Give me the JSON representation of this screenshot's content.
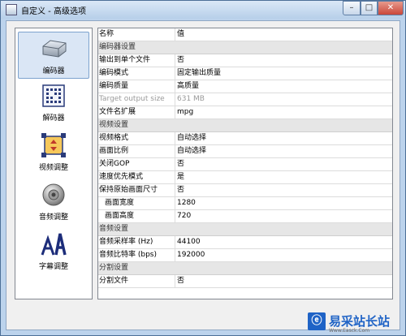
{
  "window": {
    "title": "自定义 - 高级选项",
    "buttons": {
      "minimize": "–",
      "maximize": "□",
      "close": "✕"
    }
  },
  "sidebar": {
    "items": [
      {
        "label": "编码器",
        "icon": "encoder-drive-icon",
        "selected": true
      },
      {
        "label": "解码器",
        "icon": "decoder-chip-icon",
        "selected": false
      },
      {
        "label": "视频调整",
        "icon": "video-adjust-icon",
        "selected": false
      },
      {
        "label": "音频调整",
        "icon": "speaker-icon",
        "selected": false
      },
      {
        "label": "字幕调整",
        "icon": "subtitle-icon",
        "selected": false
      }
    ]
  },
  "table": {
    "header": {
      "name": "名称",
      "value": "值"
    },
    "rows": [
      {
        "type": "section",
        "name": "编码器设置",
        "value": ""
      },
      {
        "type": "row",
        "name": "输出到单个文件",
        "value": "否"
      },
      {
        "type": "row",
        "name": "编码模式",
        "value": "固定输出质量"
      },
      {
        "type": "row",
        "name": "编码质量",
        "value": "高质量"
      },
      {
        "type": "disabled",
        "name": "Target output size",
        "value": "631 MB"
      },
      {
        "type": "row",
        "name": "文件名扩展",
        "value": "mpg"
      },
      {
        "type": "section",
        "name": "视频设置",
        "value": ""
      },
      {
        "type": "row",
        "name": "视频格式",
        "value": "自动选择"
      },
      {
        "type": "row",
        "name": "画面比例",
        "value": "自动选择"
      },
      {
        "type": "row",
        "name": "关闭GOP",
        "value": "否"
      },
      {
        "type": "row",
        "name": "速度优先模式",
        "value": "是"
      },
      {
        "type": "row",
        "name": "保持原始画面尺寸",
        "value": "否"
      },
      {
        "type": "indent",
        "name": "画面宽度",
        "value": "1280"
      },
      {
        "type": "indent",
        "name": "画面高度",
        "value": "720"
      },
      {
        "type": "section",
        "name": "音频设置",
        "value": ""
      },
      {
        "type": "row",
        "name": "音频采样率 (Hz)",
        "value": "44100"
      },
      {
        "type": "row",
        "name": "音频比特率 (bps)",
        "value": "192000"
      },
      {
        "type": "section",
        "name": "分割设置",
        "value": ""
      },
      {
        "type": "row",
        "name": "分割文件",
        "value": "否"
      }
    ]
  },
  "watermark": {
    "badge": "ⓔ",
    "text": "易采站长站",
    "sub": "Www.Easck.Com"
  },
  "colors": {
    "section_bg": "#e6e6e6",
    "selected_bg": "#dae6f5",
    "accent": "#1f63c6"
  }
}
